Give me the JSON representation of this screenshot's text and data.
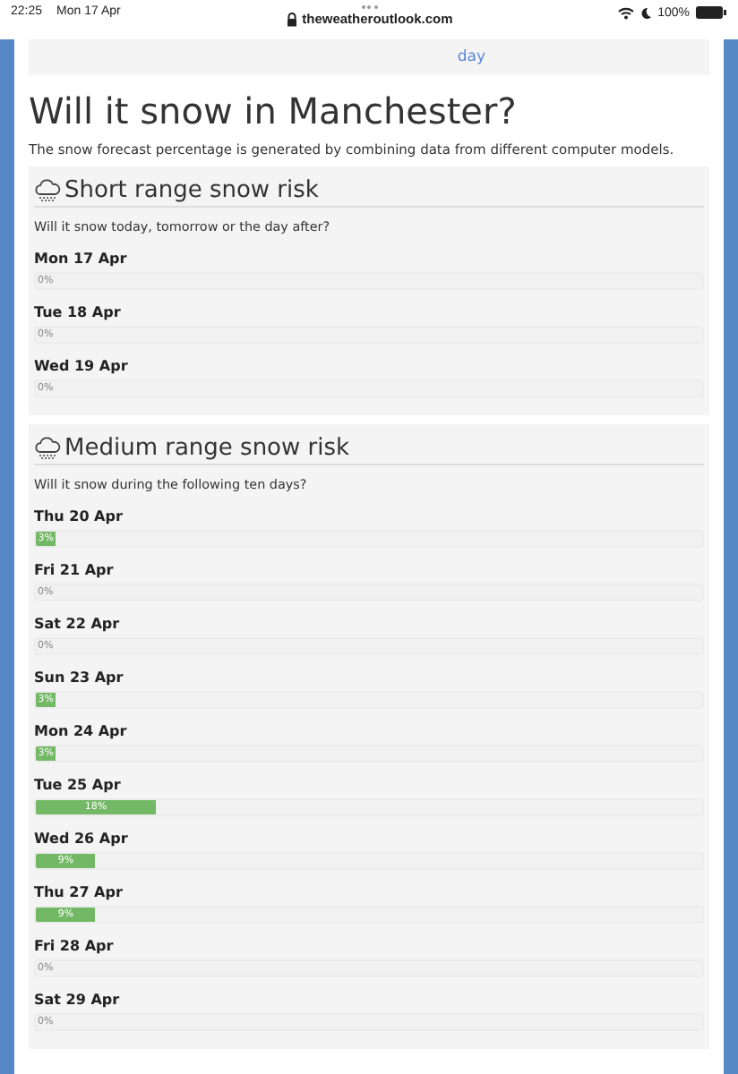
{
  "status_bar": {
    "time": "22:25",
    "date": "Mon 17 Apr",
    "url": "theweatheroutlook.com",
    "battery": "100%"
  },
  "nav": {
    "items": [
      {
        "label": "day"
      }
    ]
  },
  "title": "Will it snow in Manchester?",
  "intro": "The snow forecast percentage is generated by combining data from different computer models.",
  "sections": [
    {
      "title": "Short range snow risk",
      "question": "Will it snow today, tomorrow or the day after?",
      "days": [
        {
          "date": "Mon 17 Apr",
          "level": 0,
          "reading": "0%"
        },
        {
          "date": "Tue 18 Apr",
          "level": 0,
          "reading": "0%"
        },
        {
          "date": "Wed 19 Apr",
          "level": 0,
          "reading": "0%"
        }
      ]
    },
    {
      "title": "Medium range snow risk",
      "question": "Will it snow during the following ten days?",
      "days": [
        {
          "date": "Thu 20 Apr",
          "level": 0.03,
          "reading": "3%"
        },
        {
          "date": "Fri 21 Apr",
          "level": 0,
          "reading": "0%"
        },
        {
          "date": "Sat 22 Apr",
          "level": 0,
          "reading": "0%"
        },
        {
          "date": "Sun 23 Apr",
          "level": 0.03,
          "reading": "3%"
        },
        {
          "date": "Mon 24 Apr",
          "level": 0.03,
          "reading": "3%"
        },
        {
          "date": "Tue 25 Apr",
          "level": 0.18,
          "reading": "18%"
        },
        {
          "date": "Wed 26 Apr",
          "level": 0.09,
          "reading": "9%"
        },
        {
          "date": "Thu 27 Apr",
          "level": 0.09,
          "reading": "9%"
        },
        {
          "date": "Fri 28 Apr",
          "level": 0,
          "reading": "0%"
        },
        {
          "date": "Sat 29 Apr",
          "level": 0,
          "reading": "0%"
        }
      ]
    }
  ]
}
